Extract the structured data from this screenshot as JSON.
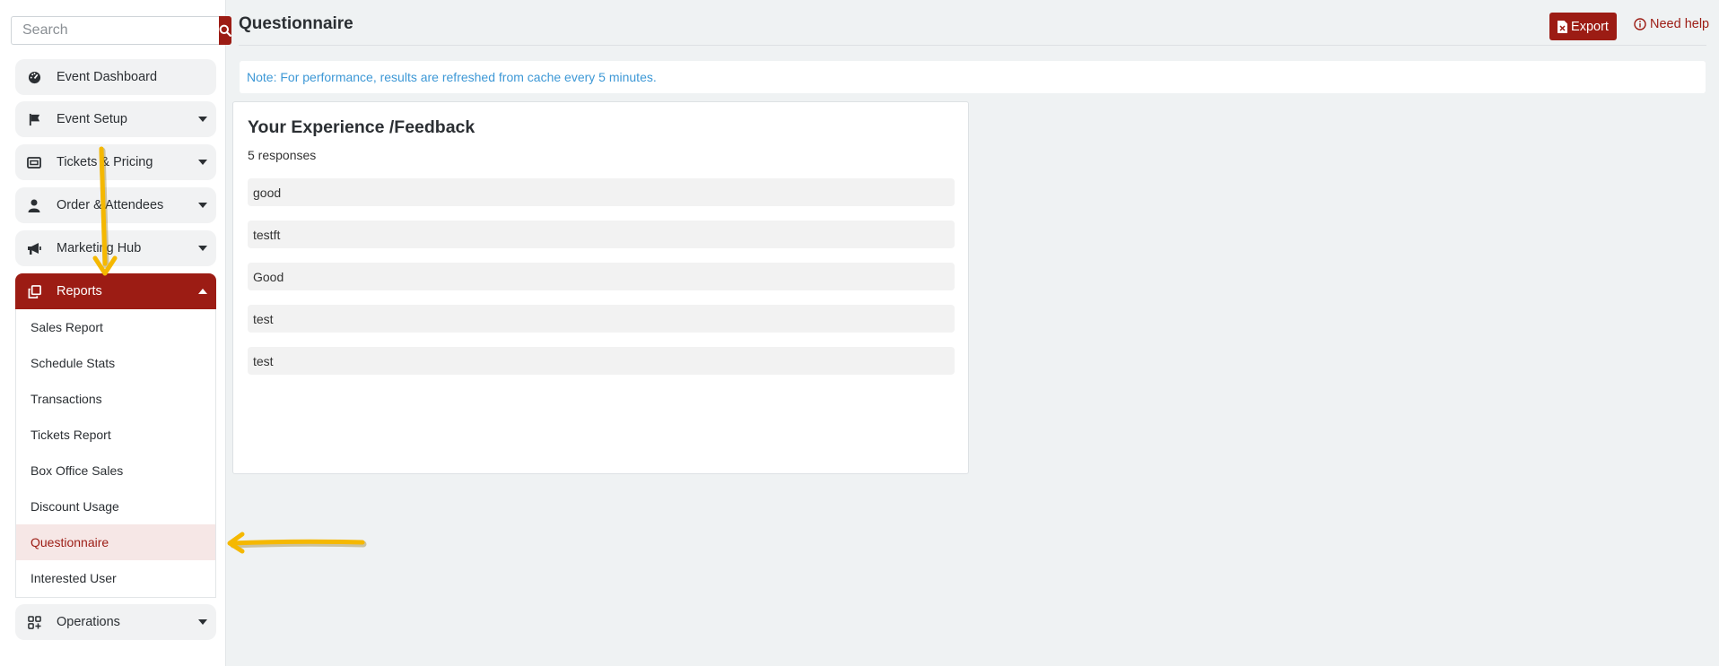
{
  "sidebar": {
    "search_placeholder": "Search",
    "items": [
      {
        "label": "Event Dashboard",
        "icon": "gauge-icon"
      },
      {
        "label": "Event Setup",
        "icon": "flag-icon"
      },
      {
        "label": "Tickets & Pricing",
        "icon": "ticket-icon"
      },
      {
        "label": "Order & Attendees",
        "icon": "user-icon"
      },
      {
        "label": "Marketing Hub",
        "icon": "megaphone-icon"
      },
      {
        "label": "Reports",
        "icon": "copy-icon",
        "expanded": true
      },
      {
        "label": "Operations",
        "icon": "grid-plus-icon"
      }
    ],
    "reports_submenu": [
      "Sales Report",
      "Schedule Stats",
      "Transactions",
      "Tickets Report",
      "Box Office Sales",
      "Discount Usage",
      "Questionnaire",
      "Interested User"
    ],
    "current_submenu_item": "Questionnaire"
  },
  "header": {
    "title": "Questionnaire",
    "export_label": "Export",
    "help_label": "Need help"
  },
  "note": "Note: For performance, results are refreshed from cache every 5 minutes.",
  "question_card": {
    "title": "Your Experience /Feedback",
    "response_count": "5 responses",
    "responses": [
      "good",
      "testft",
      "Good",
      "test",
      "test"
    ]
  },
  "colors": {
    "brand": "#9c1c14",
    "note_text": "#3d98d6",
    "annotation_arrow": "#f5b800"
  }
}
